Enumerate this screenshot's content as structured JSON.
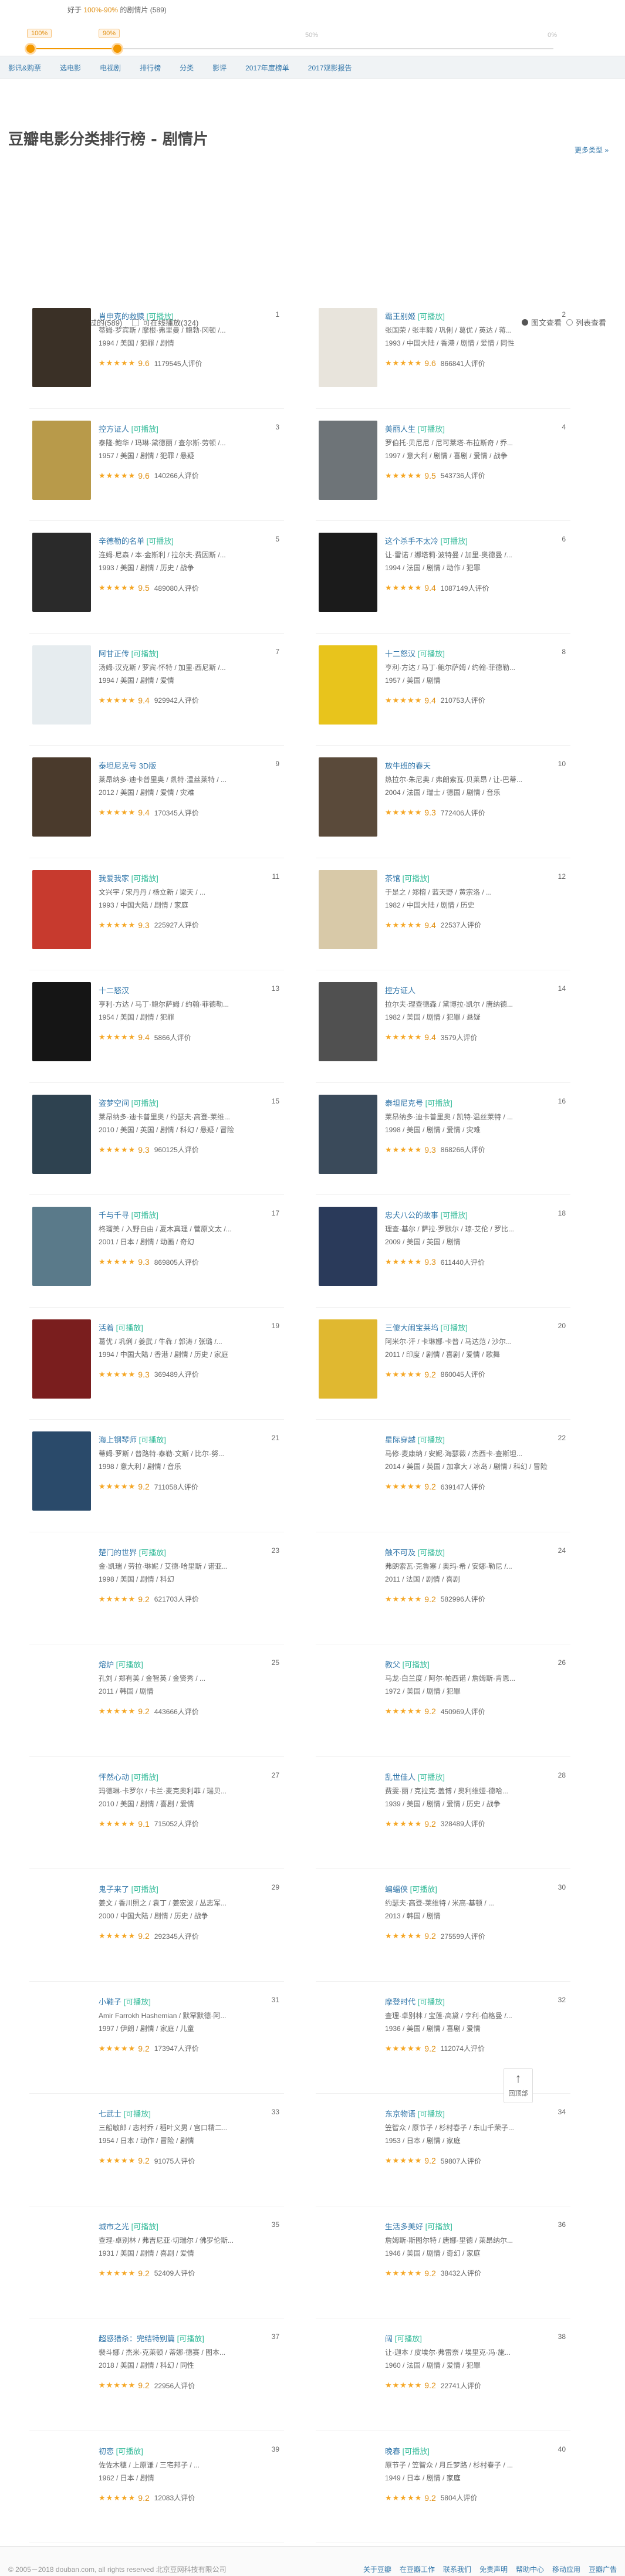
{
  "crumb": {
    "prefix": "好于",
    "range": "100%-90%",
    "suffix": "的剧情片",
    "count": "(589)"
  },
  "slider": {
    "tip_left": "100%",
    "tip_right": "90%",
    "mark_mid": "50%",
    "mark_end": "0%",
    "value": 0.13
  },
  "nav": [
    "影讯&购票",
    "选电影",
    "电视剧",
    "排行榜",
    "分类",
    "影评",
    "2017年度榜单",
    "2017观影报告"
  ],
  "page_title": "豆瓣电影分类排行榜 - 剧情片",
  "more_link": "更多类型 »",
  "filters": {
    "watched": "我没看过的(589)",
    "playable": "可在线播放(324)",
    "view_grid": "图文查看",
    "view_list": "列表查看"
  },
  "movies": [
    {
      "rank": "1",
      "title": "肖申克的救赎",
      "play": "[可播放]",
      "actors": "蒂姆·罗宾斯 / 摩根·弗里曼 / 鲍勃·冈顿 /...",
      "meta": "1994 / 美国 / 犯罪 / 剧情",
      "score": "9.6",
      "votes": "1179545人评价",
      "poster": "#3a3026"
    },
    {
      "rank": "2",
      "title": "霸王别姬",
      "play": "[可播放]",
      "actors": "张国荣 / 张丰毅 / 巩俐 / 葛优 / 英达 / 蒋...",
      "meta": "1993 / 中国大陆 / 香港 / 剧情 / 爱情 / 同性",
      "score": "9.6",
      "votes": "866841人评价",
      "poster": "#e8e4dc"
    },
    {
      "rank": "3",
      "title": "控方证人",
      "play": "[可播放]",
      "actors": "泰隆·鲍华 / 玛琳·黛德丽 / 查尔斯·劳顿 /...",
      "meta": "1957 / 美国 / 剧情 / 犯罪 / 悬疑",
      "score": "9.6",
      "votes": "140266人评价",
      "poster": "#b89a4a"
    },
    {
      "rank": "4",
      "title": "美丽人生",
      "play": "[可播放]",
      "actors": "罗伯托·贝尼尼 / 尼可莱塔·布拉斯奇 / 乔...",
      "meta": "1997 / 意大利 / 剧情 / 喜剧 / 爱情 / 战争",
      "score": "9.5",
      "votes": "543736人评价",
      "poster": "#6e7478"
    },
    {
      "rank": "5",
      "title": "辛德勒的名单",
      "play": "[可播放]",
      "actors": "连姆·尼森 / 本·金斯利 / 拉尔夫·费因斯 /...",
      "meta": "1993 / 美国 / 剧情 / 历史 / 战争",
      "score": "9.5",
      "votes": "489080人评价",
      "poster": "#2a2a2a"
    },
    {
      "rank": "6",
      "title": "这个杀手不太冷",
      "play": "[可播放]",
      "actors": "让·雷诺 / 娜塔莉·波特曼 / 加里·奥德曼 /...",
      "meta": "1994 / 法国 / 剧情 / 动作 / 犯罪",
      "score": "9.4",
      "votes": "1087149人评价",
      "poster": "#1b1b1b"
    },
    {
      "rank": "7",
      "title": "阿甘正传",
      "play": "[可播放]",
      "actors": "汤姆·汉克斯 / 罗宾·怀特 / 加里·西尼斯 /...",
      "meta": "1994 / 美国 / 剧情 / 爱情",
      "score": "9.4",
      "votes": "929942人评价",
      "poster": "#e6ecef"
    },
    {
      "rank": "8",
      "title": "十二怒汉",
      "play": "[可播放]",
      "actors": "亨利·方达 / 马丁·鲍尔萨姆 / 约翰·菲德勒...",
      "meta": "1957 / 美国 / 剧情",
      "score": "9.4",
      "votes": "210753人评价",
      "poster": "#e8c41c"
    },
    {
      "rank": "9",
      "title": "泰坦尼克号 3D版",
      "play": "",
      "actors": "莱昂纳多·迪卡普里奥 / 凯特·温丝莱特 / ...",
      "meta": "2012 / 美国 / 剧情 / 爱情 / 灾难",
      "score": "9.4",
      "votes": "170345人评价",
      "poster": "#4a3a2c"
    },
    {
      "rank": "10",
      "title": "放牛班的春天",
      "play": "",
      "actors": "热拉尔·朱尼奥 / 弗朗索瓦·贝莱昂 / 让-巴蒂...",
      "meta": "2004 / 法国 / 瑞士 / 德国 / 剧情 / 音乐",
      "score": "9.3",
      "votes": "772406人评价",
      "poster": "#5a4a3a"
    },
    {
      "rank": "11",
      "title": "我爱我家",
      "play": "[可播放]",
      "actors": "文兴宇 / 宋丹丹 / 杨立新 / 梁天 / ...",
      "meta": "1993 / 中国大陆 / 剧情 / 家庭",
      "score": "9.3",
      "votes": "225927人评价",
      "poster": "#c73a2e"
    },
    {
      "rank": "12",
      "title": "茶馆",
      "play": "[可播放]",
      "actors": "于是之 / 郑榕 / 蓝天野 / 黄宗洛 / ...",
      "meta": "1982 / 中国大陆 / 剧情 / 历史",
      "score": "9.4",
      "votes": "22537人评价",
      "poster": "#d8c9a8"
    },
    {
      "rank": "13",
      "title": "十二怒汉",
      "play": "",
      "actors": "亨利·方达 / 马丁·鲍尔萨姆 / 约翰·菲德勒...",
      "meta": "1954 / 美国 / 剧情 / 犯罪",
      "score": "9.4",
      "votes": "5866人评价",
      "poster": "#151515"
    },
    {
      "rank": "14",
      "title": "控方证人",
      "play": "",
      "actors": "拉尔夫·理查德森 / 黛博拉·凯尔 / 唐纳德...",
      "meta": "1982 / 美国 / 剧情 / 犯罪 / 悬疑",
      "score": "9.4",
      "votes": "3579人评价",
      "poster": "#505050"
    },
    {
      "rank": "15",
      "title": "盗梦空间",
      "play": "[可播放]",
      "actors": "莱昂纳多·迪卡普里奥 / 约瑟夫·高登-莱维...",
      "meta": "2010 / 美国 / 英国 / 剧情 / 科幻 / 悬疑 / 冒险",
      "score": "9.3",
      "votes": "960125人评价",
      "poster": "#2e4250"
    },
    {
      "rank": "16",
      "title": "泰坦尼克号",
      "play": "[可播放]",
      "actors": "莱昂纳多·迪卡普里奥 / 凯特·温丝莱特 / ...",
      "meta": "1998 / 美国 / 剧情 / 爱情 / 灾难",
      "score": "9.3",
      "votes": "868266人评价",
      "poster": "#3a4a5a"
    },
    {
      "rank": "17",
      "title": "千与千寻",
      "play": "[可播放]",
      "actors": "柊瑠美 / 入野自由 / 夏木真理 / 菅原文太 /...",
      "meta": "2001 / 日本 / 剧情 / 动画 / 奇幻",
      "score": "9.3",
      "votes": "869805人评价",
      "poster": "#5a7a8a"
    },
    {
      "rank": "18",
      "title": "忠犬八公的故事",
      "play": "[可播放]",
      "actors": "理查·基尔 / 萨拉·罗默尔 / 琼·艾伦 / 罗比...",
      "meta": "2009 / 美国 / 英国 / 剧情",
      "score": "9.3",
      "votes": "611440人评价",
      "poster": "#2a3a5a"
    },
    {
      "rank": "19",
      "title": "活着",
      "play": "[可播放]",
      "actors": "葛优 / 巩俐 / 姜武 / 牛犇 / 郭涛 / 张璐 /...",
      "meta": "1994 / 中国大陆 / 香港 / 剧情 / 历史 / 家庭",
      "score": "9.3",
      "votes": "369489人评价",
      "poster": "#7a1e1e"
    },
    {
      "rank": "20",
      "title": "三傻大闹宝莱坞",
      "play": "[可播放]",
      "actors": "阿米尔·汗 / 卡琳娜·卡普 / 马达范 / 沙尔...",
      "meta": "2011 / 印度 / 剧情 / 喜剧 / 爱情 / 歌舞",
      "score": "9.2",
      "votes": "860045人评价",
      "poster": "#e0b830"
    },
    {
      "rank": "21",
      "title": "海上钢琴师",
      "play": "[可播放]",
      "actors": "蒂姆·罗斯 / 普路特·泰勒·文斯 / 比尔·努...",
      "meta": "1998 / 意大利 / 剧情 / 音乐",
      "score": "9.2",
      "votes": "711058人评价",
      "poster": "#2a4a6a"
    },
    {
      "rank": "22",
      "title": "星际穿越",
      "play": "[可播放]",
      "actors": "马修·麦康纳 / 安妮·海瑟薇 / 杰西卡·查斯坦...",
      "meta": "2014 / 美国 / 英国 / 加拿大 / 冰岛 / 剧情 / 科幻 / 冒险",
      "score": "9.2",
      "votes": "639147人评价",
      "poster": ""
    },
    {
      "rank": "23",
      "title": "楚门的世界",
      "play": "[可播放]",
      "actors": "金·凯瑞 / 劳拉·琳妮 / 艾德·哈里斯 / 诺亚...",
      "meta": "1998 / 美国 / 剧情 / 科幻",
      "score": "9.2",
      "votes": "621703人评价",
      "poster": ""
    },
    {
      "rank": "24",
      "title": "触不可及",
      "play": "[可播放]",
      "actors": "弗朗索瓦·克鲁塞 / 奥玛·希 / 安娜·勒尼 /...",
      "meta": "2011 / 法国 / 剧情 / 喜剧",
      "score": "9.2",
      "votes": "582996人评价",
      "poster": ""
    },
    {
      "rank": "25",
      "title": "熔炉",
      "play": "[可播放]",
      "actors": "孔刘 / 郑有美 / 金智英 / 金贤秀 / ...",
      "meta": "2011 / 韩国 / 剧情",
      "score": "9.2",
      "votes": "443666人评价",
      "poster": ""
    },
    {
      "rank": "26",
      "title": "教父",
      "play": "[可播放]",
      "actors": "马龙·白兰度 / 阿尔·帕西诺 / 詹姆斯·肯恩...",
      "meta": "1972 / 美国 / 剧情 / 犯罪",
      "score": "9.2",
      "votes": "450969人评价",
      "poster": ""
    },
    {
      "rank": "27",
      "title": "怦然心动",
      "play": "[可播放]",
      "actors": "玛德琳·卡罗尔 / 卡兰·麦克奥利菲 / 瑞贝...",
      "meta": "2010 / 美国 / 剧情 / 喜剧 / 爱情",
      "score": "9.1",
      "votes": "715052人评价",
      "poster": ""
    },
    {
      "rank": "28",
      "title": "乱世佳人",
      "play": "[可播放]",
      "actors": "费雯·丽 / 克拉克·盖博 / 奥利维娅·德哈...",
      "meta": "1939 / 美国 / 剧情 / 爱情 / 历史 / 战争",
      "score": "9.2",
      "votes": "328489人评价",
      "poster": ""
    },
    {
      "rank": "29",
      "title": "鬼子来了",
      "play": "[可播放]",
      "actors": "姜文 / 香川照之 / 袁丁 / 姜宏波 / 丛志军...",
      "meta": "2000 / 中国大陆 / 剧情 / 历史 / 战争",
      "score": "9.2",
      "votes": "292345人评价",
      "poster": ""
    },
    {
      "rank": "30",
      "title": "蝙蝠侠",
      "play": "[可播放]",
      "actors": "约瑟夫·高登-莱维特 / 米高·基顿 / ...",
      "meta": "2013 / 韩国 / 剧情",
      "score": "9.2",
      "votes": "275599人评价",
      "poster": ""
    },
    {
      "rank": "31",
      "title": "小鞋子",
      "play": "[可播放]",
      "actors": "Amir Farrokh Hashemian / 默罕默德·阿...",
      "meta": "1997 / 伊朗 / 剧情 / 家庭 / 儿童",
      "score": "9.2",
      "votes": "173947人评价",
      "poster": ""
    },
    {
      "rank": "32",
      "title": "摩登时代",
      "play": "[可播放]",
      "actors": "查理·卓别林 / 宝莲·高黛 / 亨利·伯格曼 /...",
      "meta": "1936 / 美国 / 剧情 / 喜剧 / 爱情",
      "score": "9.2",
      "votes": "112074人评价",
      "poster": ""
    },
    {
      "rank": "33",
      "title": "七武士",
      "play": "[可播放]",
      "actors": "三船敏郎 / 志村乔 / 稻叶义男 / 宫口精二...",
      "meta": "1954 / 日本 / 动作 / 冒险 / 剧情",
      "score": "9.2",
      "votes": "91075人评价",
      "poster": ""
    },
    {
      "rank": "34",
      "title": "东京物语",
      "play": "[可播放]",
      "actors": "笠智众 / 原节子 / 杉村春子 / 东山千荣子...",
      "meta": "1953 / 日本 / 剧情 / 家庭",
      "score": "9.2",
      "votes": "59807人评价",
      "poster": ""
    },
    {
      "rank": "35",
      "title": "城市之光",
      "play": "[可播放]",
      "actors": "查理·卓别林 / 弗吉尼亚·切瑞尔 / 佛罗伦斯...",
      "meta": "1931 / 美国 / 剧情 / 喜剧 / 爱情",
      "score": "9.2",
      "votes": "52409人评价",
      "poster": ""
    },
    {
      "rank": "36",
      "title": "生活多美好",
      "play": "[可播放]",
      "actors": "詹姆斯·斯图尔特 / 唐娜·里德 / 莱昂纳尔...",
      "meta": "1946 / 美国 / 剧情 / 奇幻 / 家庭",
      "score": "9.2",
      "votes": "38432人评价",
      "poster": ""
    },
    {
      "rank": "37",
      "title": "超感猎杀：完结特别篇",
      "play": "[可播放]",
      "actors": "裴斗娜 / 杰米·克莱顿 / 蒂娜·德赛 / 图本...",
      "meta": "2018 / 美国 / 剧情 / 科幻 / 同性",
      "score": "9.2",
      "votes": "22956人评价",
      "poster": ""
    },
    {
      "rank": "38",
      "title": "阔",
      "play": "[可播放]",
      "actors": "让·迦本 / 皮埃尔·弗雷奈 / 埃里克·冯·施...",
      "meta": "1960 / 法国 / 剧情 / 爱情 / 犯罪",
      "score": "9.2",
      "votes": "22741人评价",
      "poster": ""
    },
    {
      "rank": "39",
      "title": "初恋",
      "play": "[可播放]",
      "actors": "佐佐木穗 / 上原谦 / 三宅邦子 / ...",
      "meta": "1962 / 日本 / 剧情",
      "score": "9.2",
      "votes": "12083人评价",
      "poster": ""
    },
    {
      "rank": "40",
      "title": "晚春",
      "play": "[可播放]",
      "actors": "原节子 / 笠智众 / 月丘梦路 / 杉村春子 / ...",
      "meta": "1949 / 日本 / 剧情 / 家庭",
      "score": "9.2",
      "votes": "5804人评价",
      "poster": ""
    }
  ],
  "back_to_top": "回顶部",
  "footer": {
    "copyright": "© 2005－2018 douban.com, all rights reserved 北京豆网科技有限公司",
    "links": [
      "关于豆瓣",
      "在豆瓣工作",
      "联系我们",
      "免责声明",
      "帮助中心",
      "移动应用",
      "豆瓣广告"
    ]
  }
}
